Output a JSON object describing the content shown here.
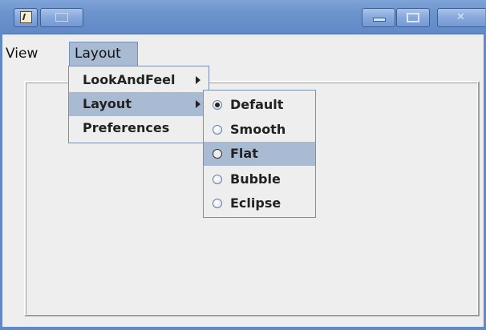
{
  "window": {
    "app_icon": "app-icon",
    "title_icon": "window-icon"
  },
  "menubar": {
    "items": [
      {
        "label": "View"
      },
      {
        "label": "Layout"
      }
    ]
  },
  "dropdown": {
    "items": [
      {
        "label": "LookAndFeel",
        "has_submenu": true
      },
      {
        "label": "Layout",
        "has_submenu": true,
        "highlighted": true
      },
      {
        "label": "Preferences",
        "has_submenu": false
      }
    ]
  },
  "submenu": {
    "items": [
      {
        "label": "Default",
        "selected": true
      },
      {
        "label": "Smooth",
        "selected": false
      },
      {
        "label": "Flat",
        "selected": false,
        "highlighted": true
      },
      {
        "label": "Bubble",
        "selected": false
      },
      {
        "label": "Eclipse",
        "selected": false
      }
    ]
  },
  "colors": {
    "titlebar": "#6c93cd",
    "highlight": "#a9bbd3",
    "background": "#eeeeee"
  }
}
